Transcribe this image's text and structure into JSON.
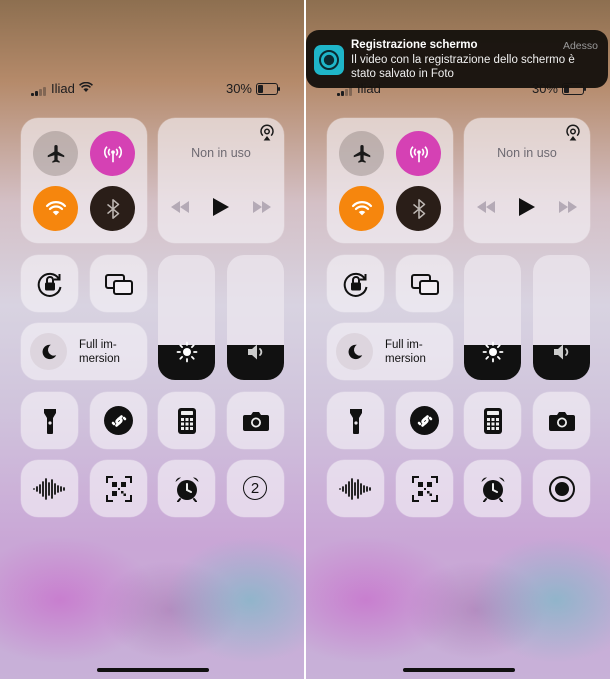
{
  "status": {
    "carrier": "Iliad",
    "battery": "30%",
    "battery_level": 0.3
  },
  "media": {
    "title": "Non in uso"
  },
  "focus": {
    "label": "Full im-\nmersion"
  },
  "brightness_level": 0.28,
  "volume_level": 0.28,
  "timer_count": "2",
  "notification": {
    "app": "Registrazione schermo",
    "time": "Adesso",
    "body": "Il video con la registrazione dello schermo è stato salvato in Foto"
  },
  "colors": {
    "cellular_active": "#d541b4",
    "wifi_active": "#f6860d",
    "bluetooth_off": "#2a1e18"
  }
}
